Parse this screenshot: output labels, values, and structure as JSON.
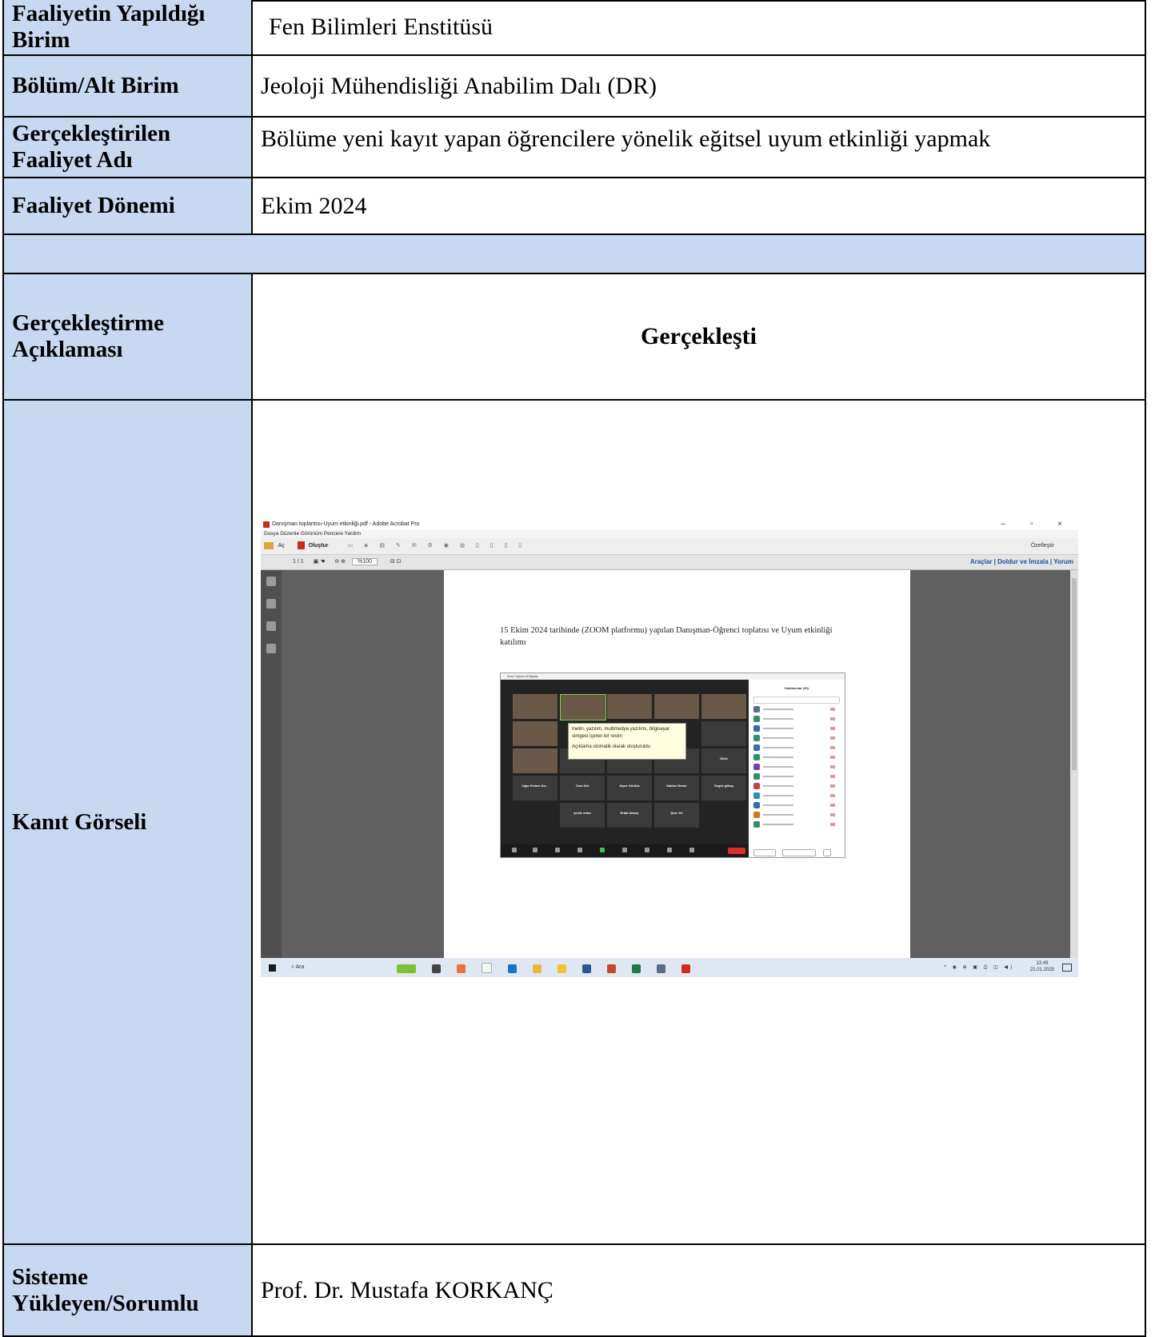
{
  "rows": [
    {
      "label": "Faaliyetin Yapıldığı Birim",
      "value": "Fen Bilimleri Enstitüsü"
    },
    {
      "label": "Bölüm/Alt Birim",
      "value": "Jeoloji Mühendisliği Anabilim Dalı (DR)"
    },
    {
      "label": "Gerçekleştirilen Faaliyet Adı",
      "value": "Bölüme yeni kayıt yapan öğrencilere yönelik eğitsel uyum etkinliği yapmak"
    },
    {
      "label": "Faaliyet Dönemi",
      "value": "Ekim 2024"
    },
    {
      "label": "Gerçekleştirme Açıklaması",
      "value": "Gerçekleşti"
    },
    {
      "label": "Kanıt Görseli"
    },
    {
      "label": "Sisteme Yükleyen/Sorumlu",
      "value": "Prof. Dr. Mustafa KORKANÇ"
    }
  ],
  "screenshot": {
    "window_title": "Danışman toplantısı-Uyum etkinliği.pdf - Adobe Acrobat Pro",
    "window_buttons": "– ▫ ×",
    "menu": "Dosya  Düzenle  Görünüm  Pencere  Yardım",
    "toolbar_open": "Aç",
    "toolbar_create": "Oluştur",
    "customize": "Özelleştir",
    "page_nav": "1 / 1",
    "zoom_level": "%100",
    "right_tools": "Araçlar  |  Doldur ve İmzala  |  Yorum",
    "page_caption": "15 Ekim 2024 tarihinde (ZOOM platformu) yapılan Danışman-Öğrenci toplatısı ve Uyum etkinliği katılımı",
    "zoom_window_title": "Zoom Toplantı Ali Baştaş",
    "participants_title": "Katılımcılar (20)",
    "tooltip_line1": "metin, yazılım, multimedya yazılımı, bilgisayar simgesi içeren bir resim",
    "tooltip_line2": "Açıklama otomatik olarak oluşturuldu",
    "tile_names": [
      "Uğur Erdem Do...",
      "Cem Ünl",
      "Alper Gürbüz",
      "Sabine Demir",
      "Özgür gökay",
      "şerife ertan",
      "Erdal Aksoy",
      "Şule Yel",
      "Dilek"
    ],
    "taskbar_search": "Ara",
    "clock_time": "13:49",
    "clock_date": "21.01.2025"
  }
}
